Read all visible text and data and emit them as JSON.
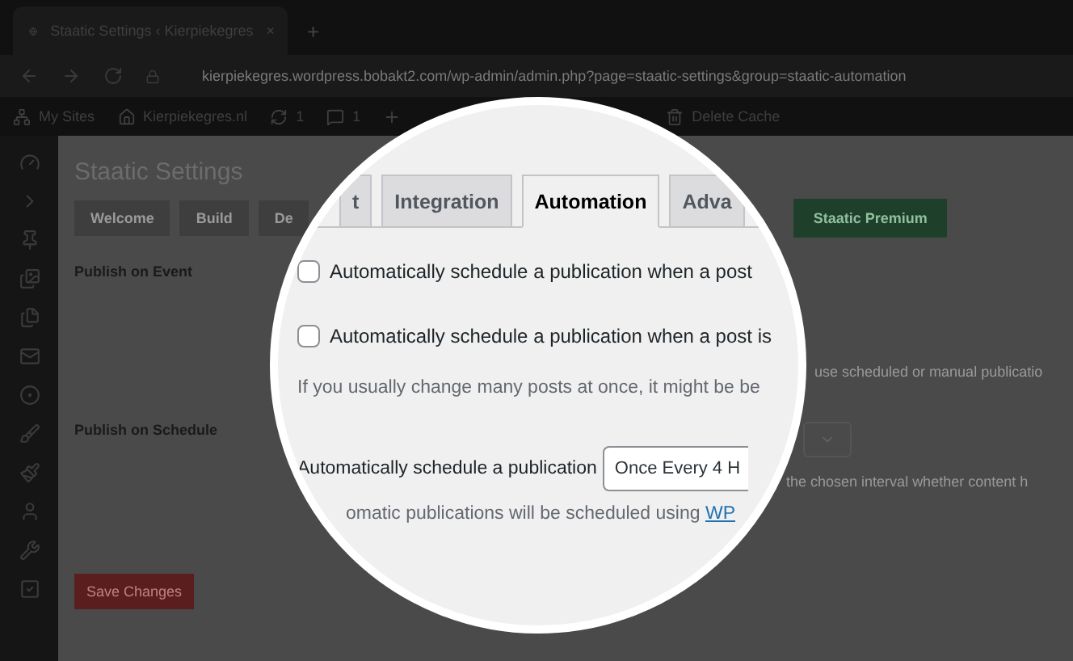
{
  "browser": {
    "tab_title": "Staatic Settings ‹ Kierpiekegres",
    "tab_close": "×",
    "new_tab": "+",
    "url": "kierpiekegres.wordpress.bobakt2.com/wp-admin/admin.php?page=staatic-settings&group=staatic-automation"
  },
  "admin_bar": [
    {
      "kind": "sites",
      "label": "My Sites"
    },
    {
      "kind": "home",
      "label": "Kierpiekegres.nl"
    },
    {
      "kind": "updates",
      "label": "1"
    },
    {
      "kind": "comments",
      "label": "1"
    },
    {
      "kind": "new"
    },
    {
      "kind": "cache",
      "label": "Delete Cache"
    }
  ],
  "page": {
    "title": "Staatic Settings",
    "tabs": [
      {
        "label": "Welcome",
        "selected": false
      },
      {
        "label": "Build",
        "selected": false
      },
      {
        "label": "De",
        "selected": false
      }
    ],
    "premium_button": "Staatic Premium",
    "sections": [
      "Publish on Event",
      "Publish on Schedule"
    ],
    "side_texts": [
      "use scheduled or manual publicatio",
      "the chosen interval whether content h"
    ],
    "save_button": "Save Changes"
  },
  "magnifier": {
    "tabs": [
      {
        "label": "t",
        "selected": false
      },
      {
        "label": "Integration",
        "selected": false
      },
      {
        "label": "Automation",
        "selected": true
      },
      {
        "label": "Adva",
        "selected": false
      }
    ],
    "checkboxes": [
      {
        "label": "Automatically schedule a publication when a post",
        "checked": false
      },
      {
        "label": "Automatically schedule a publication when a post is",
        "checked": false
      }
    ],
    "help": "If you usually change many posts at once, it might be be",
    "schedule": {
      "label": "Automatically schedule a publication",
      "value": "Once Every 4 H"
    },
    "note": {
      "text": "omatic publications will be scheduled using",
      "link": "WP"
    }
  }
}
